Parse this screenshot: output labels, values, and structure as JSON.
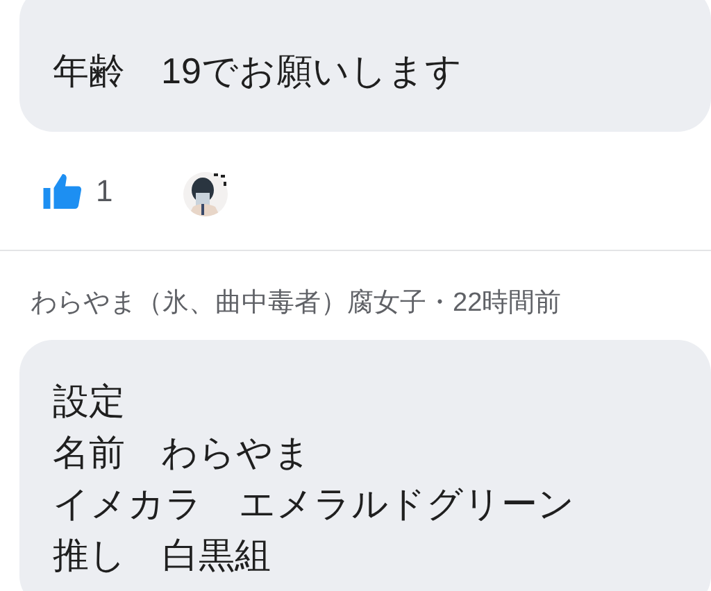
{
  "posts": [
    {
      "kind": "reply",
      "lines": [
        "年齢　19でお願いします"
      ],
      "likes": "1"
    },
    {
      "kind": "reply",
      "meta": "わらやま（氷、曲中毒者）腐女子・22時間前",
      "lines": [
        "設定",
        "名前　わらやま",
        "イメカラ　エメラルドグリーン",
        "推し　白黒組"
      ]
    }
  ]
}
